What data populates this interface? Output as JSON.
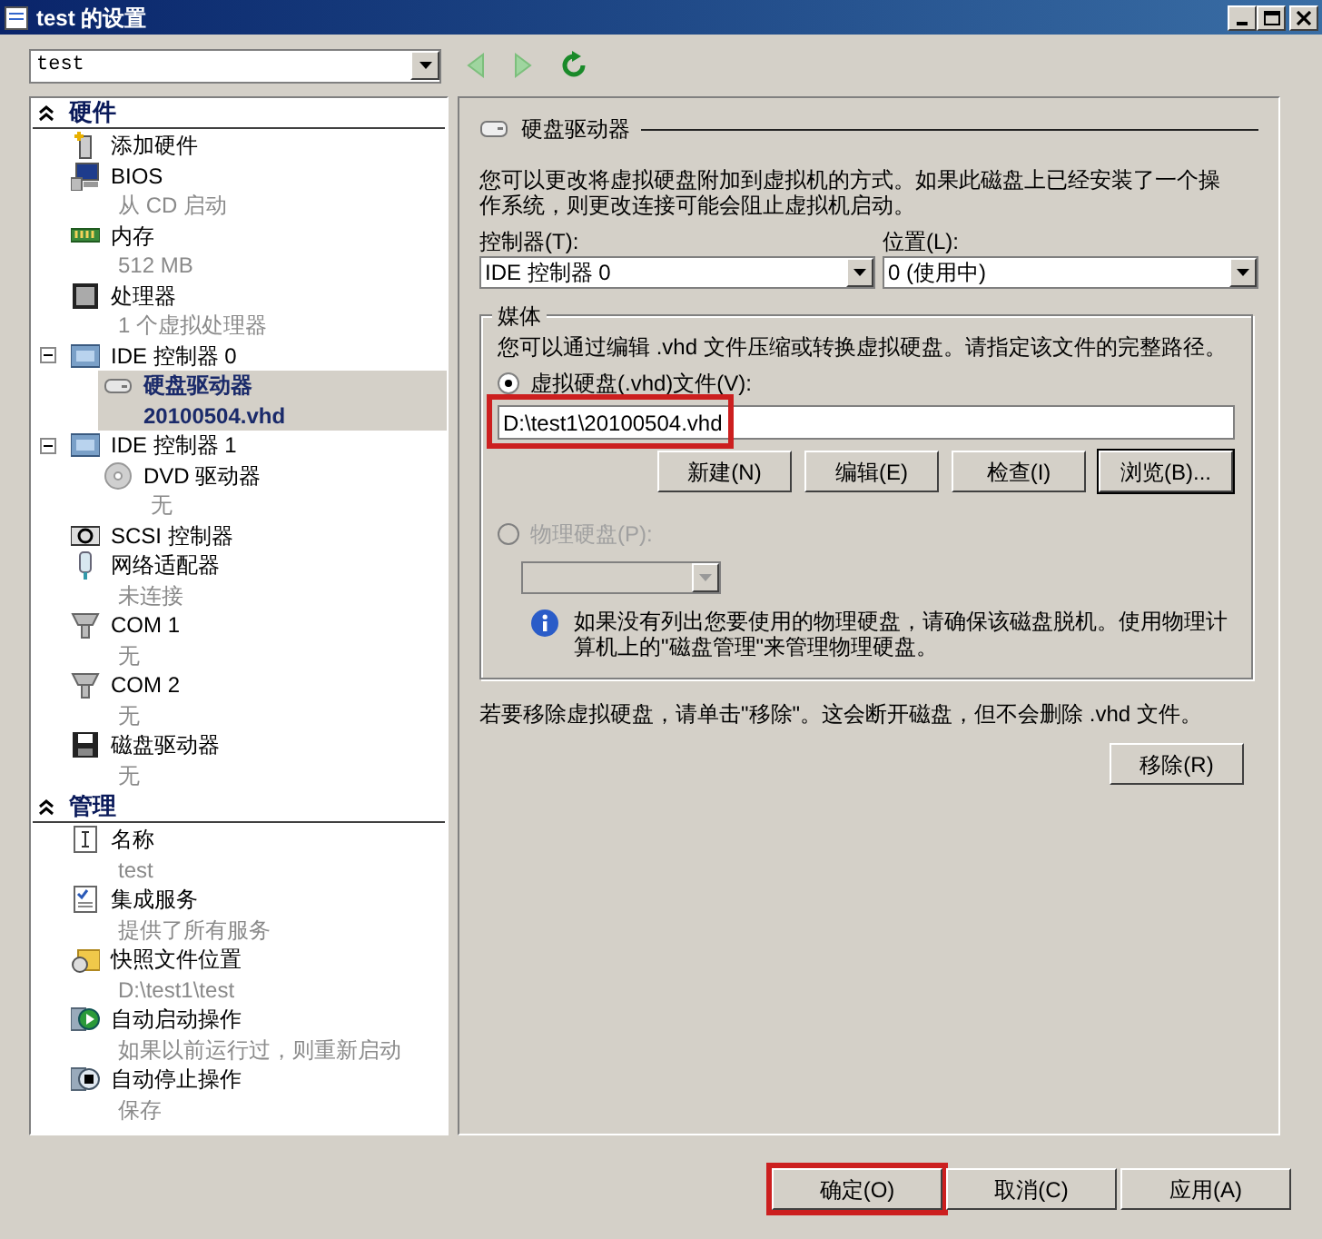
{
  "window": {
    "title": "test 的设置"
  },
  "vm_selector": {
    "value": "test"
  },
  "toolbar": {
    "back_disabled": true,
    "forward_disabled": true
  },
  "sidebar": {
    "sections": [
      {
        "title": "硬件",
        "expanded": true,
        "items": [
          {
            "kind": "add",
            "label": "添加硬件",
            "selected": false
          },
          {
            "kind": "bios",
            "label": "BIOS",
            "sublabel": "从 CD 启动",
            "selected": false
          },
          {
            "kind": "memory",
            "label": "内存",
            "sublabel": "512 MB",
            "selected": false
          },
          {
            "kind": "cpu",
            "label": "处理器",
            "sublabel": "1 个虚拟处理器",
            "selected": false
          },
          {
            "kind": "controller",
            "label": "IDE 控制器 0",
            "expanded": true,
            "selected": false,
            "children": [
              {
                "kind": "disk",
                "label": "硬盘驱动器",
                "sublabel": "20100504.vhd",
                "selected": true
              }
            ]
          },
          {
            "kind": "controller",
            "label": "IDE 控制器 1",
            "expanded": true,
            "selected": false,
            "children": [
              {
                "kind": "dvd",
                "label": "DVD 驱动器",
                "sublabel": "无",
                "selected": false
              }
            ]
          },
          {
            "kind": "scsi",
            "label": "SCSI 控制器",
            "selected": false
          },
          {
            "kind": "network",
            "label": "网络适配器",
            "sublabel": "未连接",
            "selected": false
          },
          {
            "kind": "com",
            "label": "COM 1",
            "sublabel": "无",
            "selected": false
          },
          {
            "kind": "com",
            "label": "COM 2",
            "sublabel": "无",
            "selected": false
          },
          {
            "kind": "floppy",
            "label": "磁盘驱动器",
            "sublabel": "无",
            "selected": false
          }
        ]
      },
      {
        "title": "管理",
        "expanded": true,
        "items": [
          {
            "kind": "name",
            "label": "名称",
            "sublabel": "test",
            "selected": false
          },
          {
            "kind": "services",
            "label": "集成服务",
            "sublabel": "提供了所有服务",
            "selected": false
          },
          {
            "kind": "folder",
            "label": "快照文件位置",
            "sublabel": "D:\\test1\\test",
            "selected": false
          },
          {
            "kind": "start",
            "label": "自动启动操作",
            "sublabel": "如果以前运行过，则重新启动",
            "selected": false
          },
          {
            "kind": "stop",
            "label": "自动停止操作",
            "sublabel": "保存",
            "selected": false
          }
        ]
      }
    ]
  },
  "panel": {
    "title": "硬盘驱动器",
    "description": "您可以更改将虚拟硬盘附加到虚拟机的方式。如果此磁盘上已经安装了一个操作系统，则更改连接可能会阻止虚拟机启动。",
    "controller": {
      "label": "控制器(T):",
      "value": "IDE 控制器 0"
    },
    "location": {
      "label": "位置(L):",
      "value": "0 (使用中)"
    },
    "media": {
      "title": "媒体",
      "description": "您可以通过编辑 .vhd 文件压缩或转换虚拟硬盘。请指定该文件的完整路径。",
      "options": [
        {
          "label": "虚拟硬盘(.vhd)文件(V):",
          "selected": true,
          "disabled": false
        },
        {
          "label": "物理硬盘(P):",
          "selected": false,
          "disabled": true
        }
      ],
      "path": {
        "value": "D:\\test1\\20100504.vhd",
        "highlighted": true
      },
      "buttons": [
        {
          "label": "新建(N)",
          "default": false
        },
        {
          "label": "编辑(E)",
          "default": false
        },
        {
          "label": "检查(I)",
          "default": false
        },
        {
          "label": "浏览(B)...",
          "default": true
        }
      ],
      "info": "如果没有列出您要使用的物理硬盘，请确保该磁盘脱机。使用物理计算机上的\"磁盘管理\"来管理物理硬盘。"
    },
    "remove_note": "若要移除虚拟硬盘，请单击\"移除\"。这会断开磁盘，但不会删除 .vhd 文件。",
    "remove_button": "移除(R)"
  },
  "footer": {
    "buttons": [
      {
        "label": "确定(O)",
        "highlighted": true
      },
      {
        "label": "取消(C)",
        "highlighted": false
      },
      {
        "label": "应用(A)",
        "highlighted": false
      }
    ]
  }
}
